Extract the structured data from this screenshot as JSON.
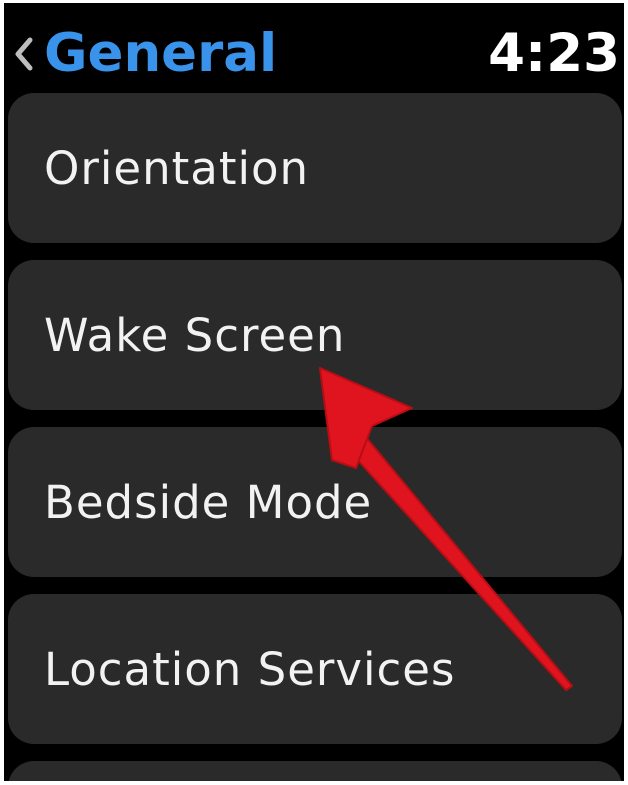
{
  "header": {
    "back_label": "General",
    "time": "4:23"
  },
  "menu": {
    "items": [
      {
        "label": "Orientation"
      },
      {
        "label": "Wake Screen"
      },
      {
        "label": "Bedside Mode"
      },
      {
        "label": "Location Services"
      }
    ]
  },
  "colors": {
    "accent": "#3a93ea",
    "background": "#000000",
    "row_background": "#2a2a2a",
    "text": "#f2f2f2",
    "annotation_arrow": "#e0141e"
  },
  "icons": {
    "back": "chevron-left-icon"
  }
}
